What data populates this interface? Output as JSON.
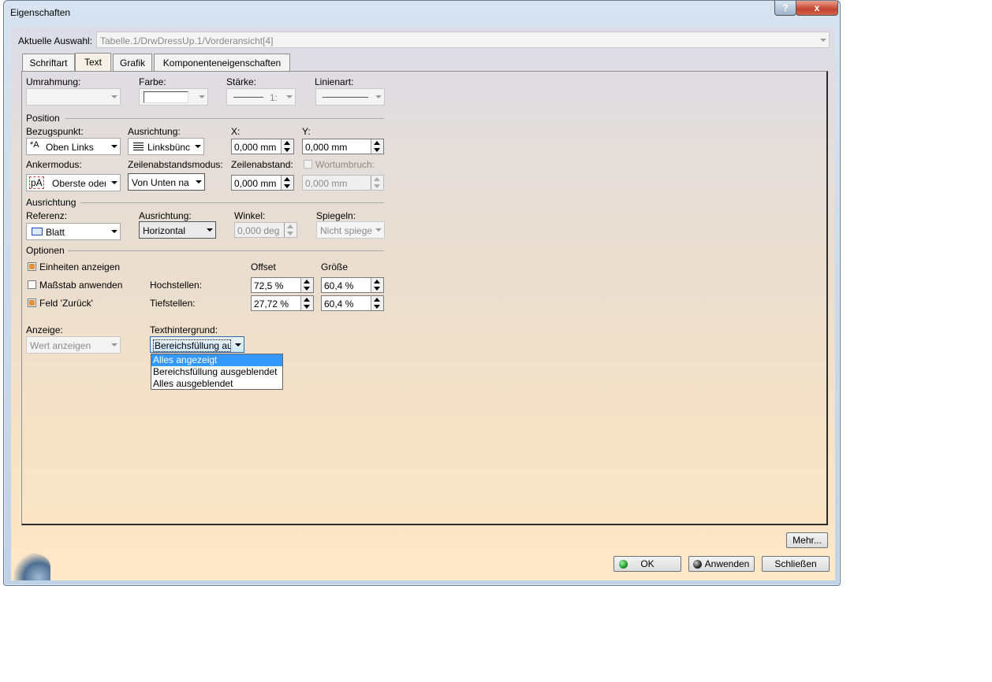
{
  "window": {
    "title": "Eigenschaften",
    "help_label": "?",
    "close_label": "x"
  },
  "selection": {
    "label": "Aktuelle Auswahl:",
    "value": "Tabelle.1/DrwDressUp.1/Vorderansicht[4]"
  },
  "tabs": [
    {
      "label": "Schriftart"
    },
    {
      "label": "Text"
    },
    {
      "label": "Grafik"
    },
    {
      "label": "Komponenteneigenschaften"
    }
  ],
  "frame": {
    "umrahmung_label": "Umrahmung:",
    "farbe_label": "Farbe:",
    "staerke_label": "Stärke:",
    "staerke_value": "1:",
    "linienart_label": "Linienart:"
  },
  "position": {
    "section_label": "Position",
    "bezugspunkt_label": "Bezugspunkt:",
    "bezugspunkt_value": "Oben Links",
    "ausrichtung_label": "Ausrichtung:",
    "ausrichtung_value": "Linksbünc",
    "x_label": "X:",
    "x_value": "0,000 mm",
    "y_label": "Y:",
    "y_value": "0,000 mm",
    "ankermodus_label": "Ankermodus:",
    "ankermodus_value": "Oberste oder",
    "zeilenabstandsmodus_label": "Zeilenabstandsmodus:",
    "zeilenabstandsmodus_value": "Von Unten na",
    "zeilenabstand_label": "Zeilenabstand:",
    "zeilenabstand_value": "0,000 mm",
    "wortumbruch_label": "Wortumbruch:",
    "wortumbruch_value": "0,000 mm"
  },
  "orientation": {
    "section_label": "Ausrichtung",
    "referenz_label": "Referenz:",
    "referenz_value": "Blatt",
    "ausrichtung_label": "Ausrichtung:",
    "ausrichtung_value": "Horizontal",
    "winkel_label": "Winkel:",
    "winkel_value": "0,000 deg",
    "spiegeln_label": "Spiegeln:",
    "spiegeln_value": "Nicht spiege"
  },
  "options": {
    "section_label": "Optionen",
    "einheiten_label": "Einheiten anzeigen",
    "einheiten_checked": true,
    "massstab_label": "Maßstab anwenden",
    "massstab_checked": false,
    "feld_label": "Feld 'Zurück'",
    "feld_checked": true,
    "offset_header": "Offset",
    "groesse_header": "Größe",
    "hochstellen_label": "Hochstellen:",
    "hochstellen_offset": "72,5 %",
    "hochstellen_groesse": "60,4 %",
    "tiefstellen_label": "Tiefstellen:",
    "tiefstellen_offset": "27,72 %",
    "tiefstellen_groesse": "60,4 %"
  },
  "display": {
    "anzeige_label": "Anzeige:",
    "anzeige_value": "Wert anzeigen",
    "texthintergrund_label": "Texthintergrund:",
    "texthintergrund_value": "Bereichsfüllung au",
    "dropdown_options": [
      "Alles angezeigt",
      "Bereichsfüllung ausgeblendet",
      "Alles ausgeblendet"
    ]
  },
  "buttons": {
    "mehr": "Mehr...",
    "ok": "OK",
    "anwenden": "Anwenden",
    "schliessen": "Schließen"
  },
  "colors": {
    "highlight": "#3399ff",
    "check_fill": "#e8913a",
    "ok_dot": "#1f9a2c"
  }
}
